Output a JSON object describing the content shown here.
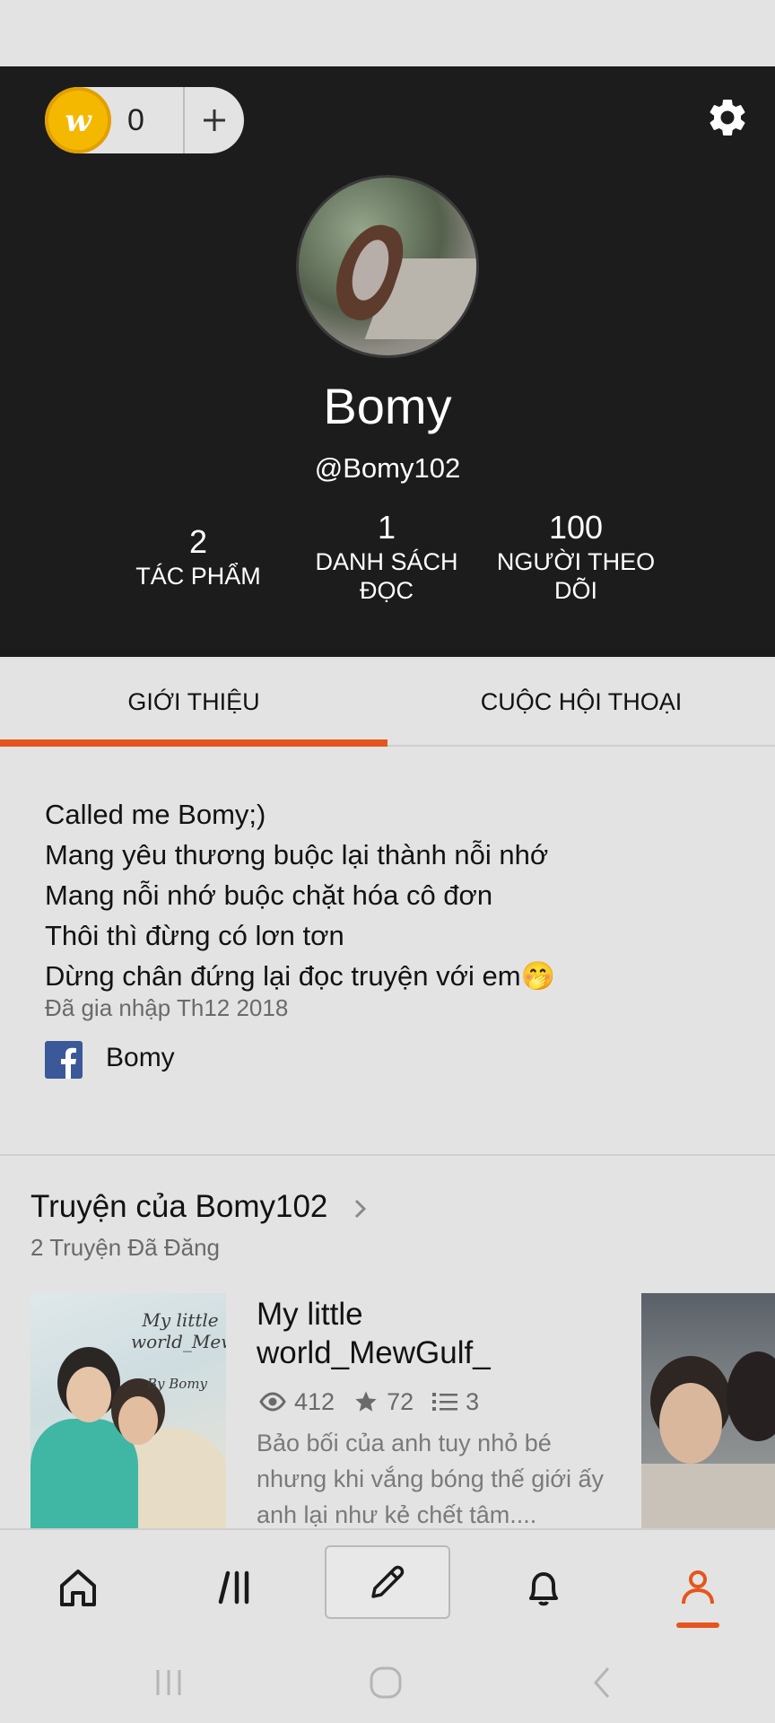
{
  "header": {
    "coin_count": "0",
    "coin_add_label": "+",
    "display_name": "Bomy",
    "username": "@Bomy102",
    "stats": [
      {
        "value": "2",
        "label_lines": [
          "TÁC PHẨM"
        ]
      },
      {
        "value": "1",
        "label_lines": [
          "DANH SÁCH",
          "ĐỌC"
        ]
      },
      {
        "value": "100",
        "label_lines": [
          "NGƯỜI THEO",
          "DÕI"
        ]
      }
    ]
  },
  "tabs": [
    {
      "label": "GIỚI THIỆU",
      "active": true
    },
    {
      "label": "CUỘC HỘI THOẠI",
      "active": false
    }
  ],
  "about": {
    "bio_lines": [
      "Called me Bomy;)",
      "Mang yêu thương buộc lại thành nỗi nhớ",
      "Mang nỗi nhớ buộc chặt hóa cô đơn",
      "Thôi thì đừng có lơn tơn",
      "Dừng chân đứng lại đọc truyện với em🤭"
    ],
    "joined": "Đã gia nhập Th12 2018",
    "facebook_name": "Bomy"
  },
  "stories_section": {
    "title": "Truyện của Bomy102",
    "subtitle": "2 Truyện Đã Đăng",
    "stories": [
      {
        "title": "My little world_MewGulf_",
        "views": "412",
        "votes": "72",
        "parts": "3",
        "description": "Bảo bối của anh tuy nhỏ bé nhưng khi vắng bóng thế giới ấy anh lại như kẻ chết tâm....",
        "cover_text": "My little world_MewGulf",
        "cover_byline": "By Bomy"
      }
    ]
  },
  "bottom_nav": {
    "items": [
      "home-icon",
      "library-icon",
      "write-icon",
      "notifications-icon",
      "profile-icon"
    ],
    "active": "profile-icon"
  },
  "colors": {
    "accent": "#e4561d",
    "header_bg": "#1c1c1c",
    "page_bg": "#e3e3e3",
    "facebook": "#3b5998",
    "coin": "#f5b800"
  }
}
